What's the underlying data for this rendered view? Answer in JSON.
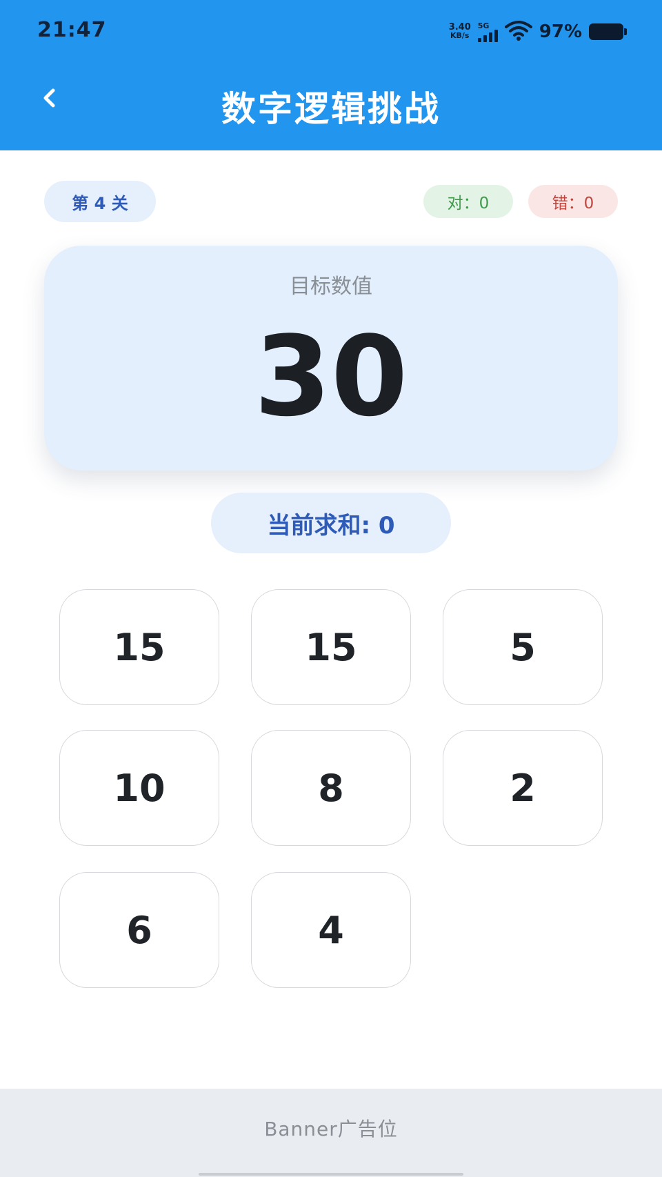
{
  "status_bar": {
    "time": "21:47",
    "net_speed_value": "3.40",
    "net_speed_unit": "KB/s",
    "network_type": "5G",
    "battery_percent": "97%"
  },
  "header": {
    "title": "数字逻辑挑战",
    "back_icon": "chevron-left-icon"
  },
  "stats": {
    "level": "第 4 关",
    "correct": "对：0",
    "wrong": "错：0"
  },
  "target": {
    "label": "目标数值",
    "value": "30"
  },
  "current_sum": "当前求和: 0",
  "tiles": [
    "15",
    "15",
    "5",
    "10",
    "8",
    "2",
    "6",
    "4"
  ],
  "banner": {
    "text": "Banner广告位"
  },
  "colors": {
    "header_bg": "#2295ee",
    "accent_blue": "#2f5bb8",
    "correct_green": "#3f9a4a",
    "wrong_red": "#c0463d",
    "target_card_bg": "#e3effd"
  }
}
